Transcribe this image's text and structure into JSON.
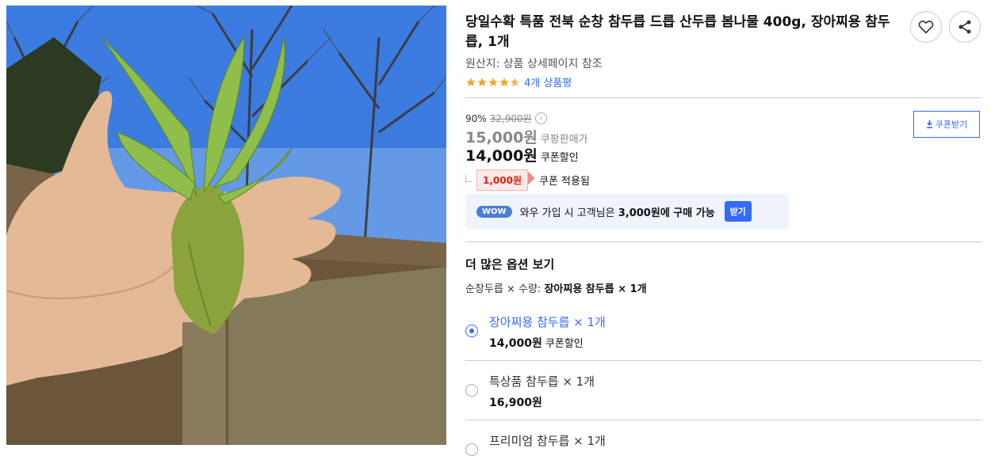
{
  "product": {
    "title": "당일수확 특품 전북 순창 참두릅 드릅 산두릅 봄나물 400g, 장아찌용 참두릅, 1개",
    "origin": "원산지: 상품 상세페이지 참조",
    "rating_stars": 4.5,
    "review_link": "4개 상품평"
  },
  "actions": {
    "wishlist_icon": "heart-icon",
    "share_icon": "share-icon"
  },
  "price": {
    "discount_rate": "90%",
    "original_price": "32,900원",
    "sale_price": "15,000원",
    "sale_label": "쿠팡판매가",
    "coupon_price": "14,000원",
    "coupon_label": "쿠폰할인",
    "coupon_amount": "1,000원",
    "coupon_applied": "쿠폰 적용됨",
    "coupon_button": "쿠폰받기"
  },
  "wow": {
    "badge": "WOW",
    "text_prefix": "와우 가입 시 고객님은 ",
    "text_bold": "3,000원에 구매 가능",
    "button": "받기"
  },
  "options": {
    "section_title": "더 많은 옵션 보기",
    "summary_prefix": "순창두릅 × 수량: ",
    "summary_value": "장아찌용 참두릅 × 1개",
    "items": [
      {
        "name": "장아찌용 참두릅 × 1개",
        "price": "14,000원",
        "price_note": "쿠폰할인",
        "selected": true
      },
      {
        "name": "특상품 참두릅 × 1개",
        "price": "16,900원",
        "price_note": "",
        "selected": false
      },
      {
        "name": "프리미엄 참두릅 × 1개",
        "price": "",
        "price_note": "",
        "selected": false
      }
    ]
  },
  "colors": {
    "accent": "#346aff",
    "coupon_red": "#d9230f",
    "star": "#f5a623"
  }
}
